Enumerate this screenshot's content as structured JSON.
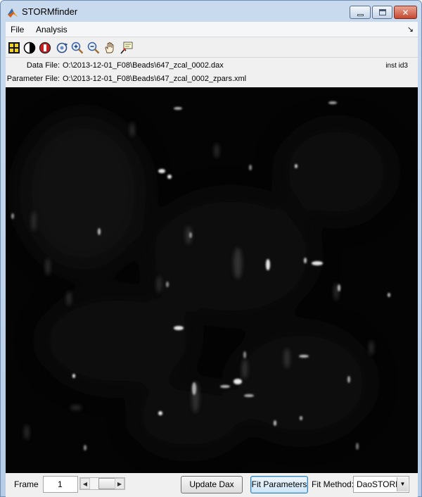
{
  "window": {
    "title": "STORMfinder",
    "app_icon": "matlab-icon"
  },
  "menu": {
    "items": [
      {
        "label": "File"
      },
      {
        "label": "Analysis"
      }
    ],
    "overflow_icon": "menu-overflow-arrow-icon"
  },
  "toolbar": {
    "tools": [
      {
        "icon": "select-grid-icon"
      },
      {
        "icon": "contrast-icon"
      },
      {
        "icon": "record-icon"
      },
      {
        "icon": "rotate-3d-icon"
      },
      {
        "icon": "zoom-in-icon"
      },
      {
        "icon": "zoom-out-icon"
      },
      {
        "icon": "pan-hand-icon"
      },
      {
        "icon": "data-cursor-icon"
      }
    ]
  },
  "info": {
    "data_file_label": "Data File:",
    "data_file_value": "O:\\2013-12-01_F08\\Beads\\647_zcal_0002.dax",
    "param_file_label": "Parameter File:",
    "param_file_value": "O:\\2013-12-01_F08\\Beads\\647_zcal_0002_zpars.xml",
    "instance_tag": "inst id3"
  },
  "bottom": {
    "frame_label": "Frame",
    "frame_value": "1",
    "update_button": "Update Dax File",
    "fit_button": "Fit Parameters",
    "fit_method_label": "Fit Method:",
    "fit_method_value": "DaoSTORM"
  },
  "colors": {
    "accent": "#3c7fb1",
    "image_background": "#040404"
  }
}
